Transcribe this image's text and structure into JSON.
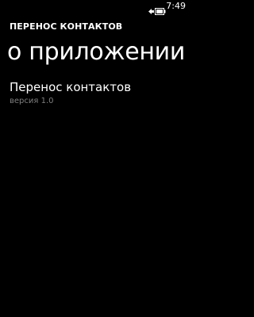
{
  "status_bar": {
    "time": "7:49",
    "battery_icon": "battery-charging-icon"
  },
  "header": {
    "app_title": "ПЕРЕНОС КОНТАКТОВ",
    "page_title": "о приложении"
  },
  "content": {
    "app_name": "Перенос контактов",
    "version": "версия 1.0"
  },
  "colors": {
    "background": "#000000",
    "foreground": "#ffffff",
    "subtle": "#7f7f7f"
  }
}
